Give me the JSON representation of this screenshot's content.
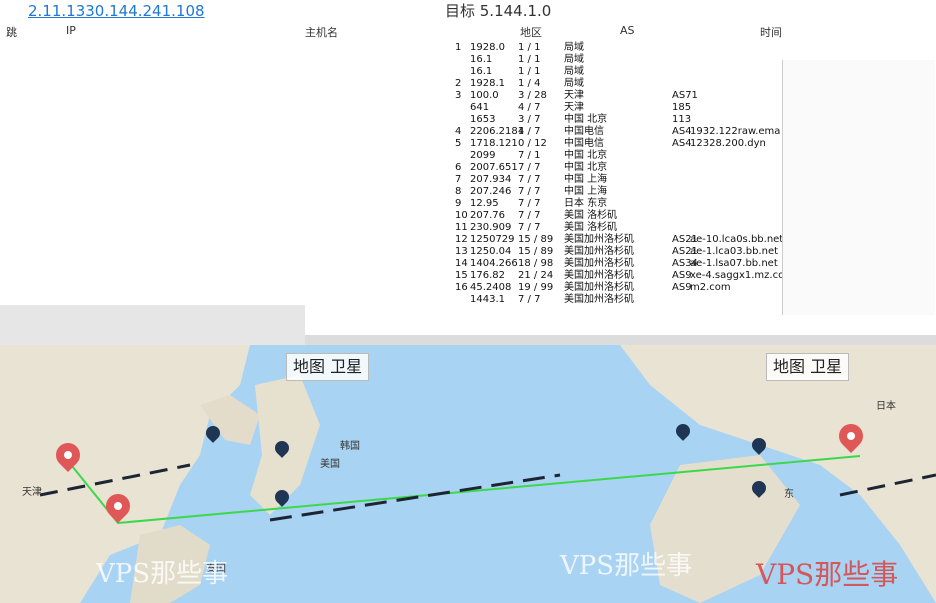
{
  "window": {
    "title_ip": "2.11.1330.144.241.108",
    "title_center": "目标 5.144.1.0"
  },
  "table": {
    "headers": [
      "跳",
      "IP",
      "主机名",
      "地区",
      "AS",
      "时间"
    ],
    "rows": [
      {
        "hop": "1",
        "ms": "1928.0",
        "loss": "1 / 1",
        "region": "局域"
      },
      {
        "hop": "",
        "ms": "16.1",
        "loss": "1 / 1",
        "region": "局域"
      },
      {
        "hop": "",
        "ms": "16.1",
        "loss": "1 / 1",
        "region": "局域"
      },
      {
        "hop": "2",
        "ms": "1928.1",
        "loss": "1 / 4",
        "region": "局域"
      },
      {
        "hop": "3",
        "ms": "100.0",
        "loss": "3 / 28",
        "region": "天津",
        "as": "AS71"
      },
      {
        "hop": "",
        "ms": "641",
        "loss": "4 / 7",
        "region": "天津",
        "as": "185"
      },
      {
        "hop": "",
        "ms": "1653",
        "loss": "3 / 7",
        "region": "中国 北京",
        "as": "113"
      },
      {
        "hop": "4",
        "ms": "2206.2181",
        "loss": "4 / 7",
        "region": "中国电信",
        "as": "AS4",
        "host": "1932.122raw.ema"
      },
      {
        "hop": "5",
        "ms": "1718.121",
        "loss": "0 / 12",
        "region": "中国电信",
        "as": "AS4",
        "host": "12328.200.dyn"
      },
      {
        "hop": "",
        "ms": "2099",
        "loss": "7 / 1",
        "region": "中国 北京"
      },
      {
        "hop": "6",
        "ms": "2007.651",
        "loss": "7 / 7",
        "region": "中国 北京"
      },
      {
        "hop": "7",
        "ms": "207.934",
        "loss": "7 / 7",
        "region": "中国 上海"
      },
      {
        "hop": "8",
        "ms": "207.246",
        "loss": "7 / 7",
        "region": "中国 上海"
      },
      {
        "hop": "9",
        "ms": "12.95",
        "loss": "7 / 7",
        "region": "日本 东京"
      },
      {
        "hop": "10",
        "ms": "207.76",
        "loss": "7 / 7",
        "region": "美国 洛杉矶"
      },
      {
        "hop": "11",
        "ms": "230.909",
        "loss": "7 / 7",
        "region": "美国 洛杉矶"
      },
      {
        "hop": "12",
        "ms": "1250729",
        "loss": "15 / 89",
        "region": "美国加州洛杉矶",
        "as": "AS21",
        "host": "ae-10.lca0s.bb.net"
      },
      {
        "hop": "13",
        "ms": "1250.04",
        "loss": "15 / 89",
        "region": "美国加州洛杉矶",
        "as": "AS21",
        "host": "ae-1.lca03.bb.net"
      },
      {
        "hop": "14",
        "ms": "1404.266",
        "loss": "18 / 98",
        "region": "美国加州洛杉矶",
        "as": "AS34",
        "host": "ae-1.lsa07.bb.net"
      },
      {
        "hop": "15",
        "ms": "176.82",
        "loss": "21 / 24",
        "region": "美国加州洛杉矶",
        "as": "AS9",
        "host": "xe-4.saggx1.mz.com"
      },
      {
        "hop": "16",
        "ms": "45.2408",
        "loss": "19 / 99",
        "region": "美国加州洛杉矶",
        "as": "AS9",
        "host": "m2.com"
      },
      {
        "hop": "",
        "ms": "1443.1",
        "loss": "7 / 7",
        "region": "美国加州洛杉矶"
      }
    ]
  },
  "map": {
    "toggle_left": [
      "地图",
      "卫星"
    ],
    "toggle_right": [
      "地图",
      "卫星"
    ],
    "labels": [
      "天津",
      "日本",
      "韩国",
      "美国",
      "泰国",
      "东"
    ],
    "watermarks": [
      "VPS那些事",
      "VPS那些事",
      "VPS那些事"
    ],
    "route_color": "#3bd84a",
    "pin_color": "#e05757"
  }
}
